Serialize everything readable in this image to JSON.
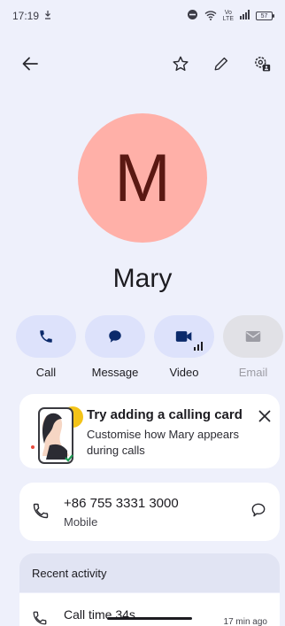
{
  "status": {
    "time": "17:19",
    "battery": "57",
    "network_top": "Vo",
    "network_bottom": "LTE"
  },
  "toolbar": {
    "back_icon": "arrow-left-icon",
    "favorite_icon": "star-outline-icon",
    "edit_icon": "pencil-icon",
    "settings_icon": "contact-settings-icon"
  },
  "contact": {
    "initial": "M",
    "name": "Mary",
    "avatar_color": "#ffb0a8",
    "initial_color": "#5a1812"
  },
  "actions": [
    {
      "label": "Call",
      "icon": "phone-icon",
      "enabled": true
    },
    {
      "label": "Message",
      "icon": "chat-bubble-icon",
      "enabled": true
    },
    {
      "label": "Video",
      "icon": "video-camera-icon",
      "enabled": true
    },
    {
      "label": "Email",
      "icon": "mail-icon",
      "enabled": false
    }
  ],
  "calling_card": {
    "title": "Try adding a calling card",
    "subtitle": "Customise how Mary appears during calls"
  },
  "phone": {
    "number": "+86 755 3331 3000",
    "type": "Mobile"
  },
  "recent": {
    "header": "Recent activity",
    "item_title": "Call time 34s",
    "item_time": "17 min ago"
  },
  "colors": {
    "background": "#eef0fb",
    "action_pill": "#dde2fb",
    "action_icon": "#0b2a6b",
    "card": "#ffffff"
  }
}
